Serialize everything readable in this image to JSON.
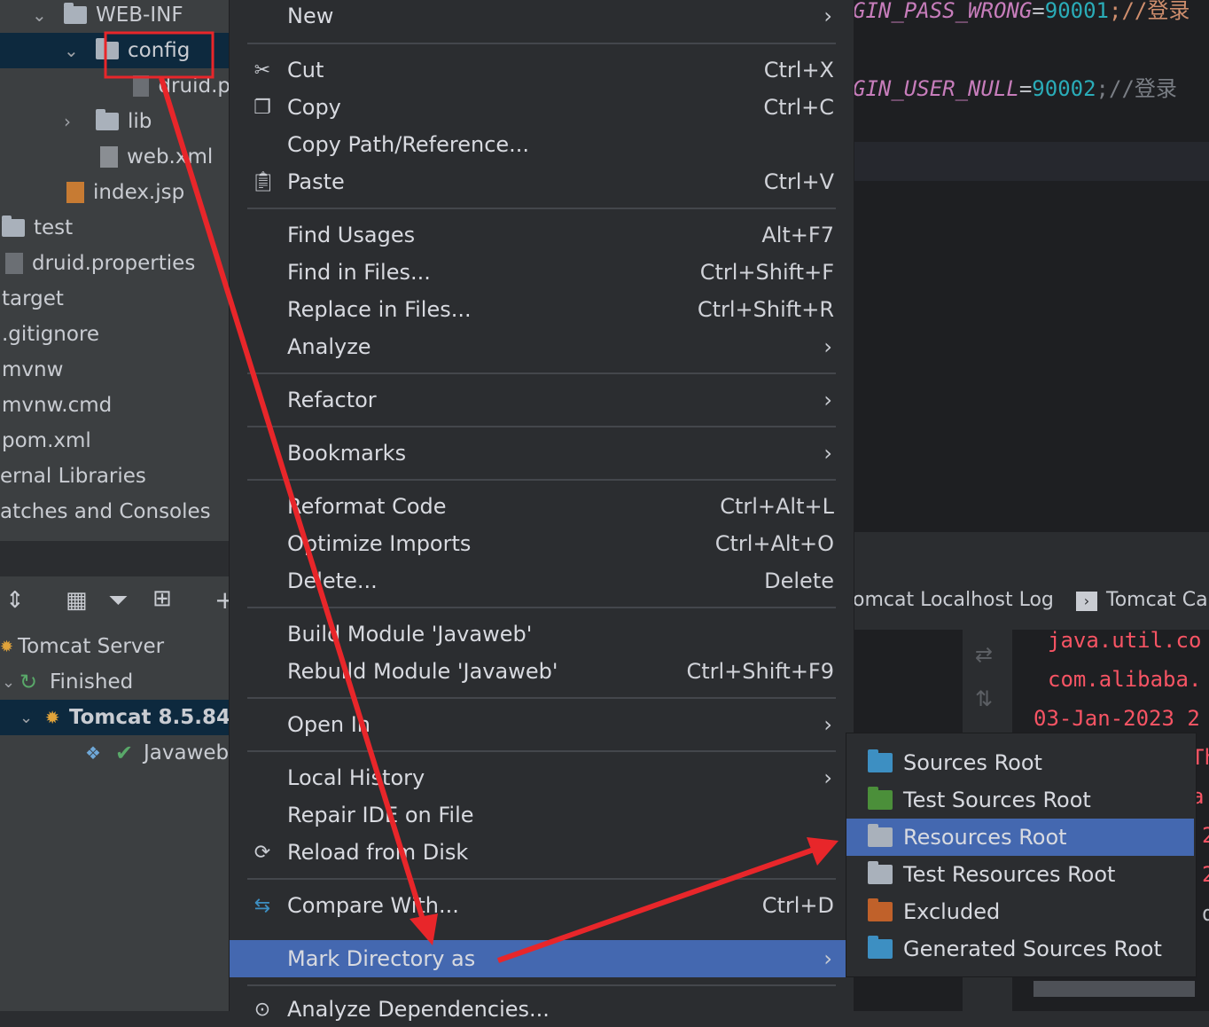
{
  "tree": {
    "items": [
      {
        "label": "WEB-INF"
      },
      {
        "label": "config"
      },
      {
        "label": "druid.p"
      },
      {
        "label": "lib"
      },
      {
        "label": "web.xml"
      },
      {
        "label": "index.jsp"
      },
      {
        "label": "test"
      },
      {
        "label": "druid.properties"
      },
      {
        "label": "target"
      },
      {
        "label": ".gitignore"
      },
      {
        "label": "mvnw"
      },
      {
        "label": "mvnw.cmd"
      },
      {
        "label": "pom.xml"
      },
      {
        "label": "ernal Libraries"
      },
      {
        "label": "atches and Consoles"
      }
    ]
  },
  "services": {
    "items": [
      {
        "label": "Tomcat Server"
      },
      {
        "label": "Finished"
      },
      {
        "label": "Tomcat 8.5.84"
      },
      {
        "label": "Javaweb"
      }
    ]
  },
  "editor": {
    "line1_name": "GIN_PASS_WRONG",
    "line1_eq": "=",
    "line1_val": "90001",
    "line1_tail": ";//登录",
    "line2_name": "GIN_USER_NULL",
    "line2_eq": "=",
    "line2_val": "90002",
    "line2_tail": ";//登录"
  },
  "log_tabs": {
    "tab1": "omcat Localhost Log",
    "tab2": "Tomcat Ca"
  },
  "log": {
    "line1": "java.util.co",
    "line2": "com.alibaba.",
    "line3": "03-Jan-2023 2",
    "frag1": "Th",
    "frag2": "a.",
    "frag3": "2",
    "frag4": "2",
    "frag5": "2",
    "frag6": "d"
  },
  "menu": {
    "new": "New",
    "cut": "Cut",
    "cut_sc": "Ctrl+X",
    "copy": "Copy",
    "copy_sc": "Ctrl+C",
    "copy_path": "Copy Path/Reference...",
    "paste": "Paste",
    "paste_sc": "Ctrl+V",
    "find_usages": "Find Usages",
    "find_usages_sc": "Alt+F7",
    "find_in_files": "Find in Files...",
    "find_in_files_sc": "Ctrl+Shift+F",
    "replace_in_files": "Replace in Files...",
    "replace_in_files_sc": "Ctrl+Shift+R",
    "analyze": "Analyze",
    "refactor": "Refactor",
    "bookmarks": "Bookmarks",
    "reformat": "Reformat Code",
    "reformat_sc": "Ctrl+Alt+L",
    "optimize": "Optimize Imports",
    "optimize_sc": "Ctrl+Alt+O",
    "delete": "Delete...",
    "delete_sc": "Delete",
    "build_module": "Build Module 'Javaweb'",
    "rebuild_module": "Rebuild Module 'Javaweb'",
    "rebuild_sc": "Ctrl+Shift+F9",
    "open_in": "Open In",
    "local_history": "Local History",
    "repair_ide": "Repair IDE on File",
    "reload": "Reload from Disk",
    "compare": "Compare With...",
    "compare_sc": "Ctrl+D",
    "mark_dir": "Mark Directory as",
    "analyze_deps": "Analyze Dependencies..."
  },
  "submenu": {
    "sources_root": "Sources Root",
    "test_sources_root": "Test Sources Root",
    "resources_root": "Resources Root",
    "test_resources_root": "Test Resources Root",
    "excluded": "Excluded",
    "generated_sources_root": "Generated Sources Root"
  },
  "colors": {
    "highlight": "#4468b0",
    "annotation_red": "#e8262a",
    "sources_blue": "#3d8fc2",
    "test_green": "#4b8f3a",
    "excluded_orange": "#c0612a"
  }
}
